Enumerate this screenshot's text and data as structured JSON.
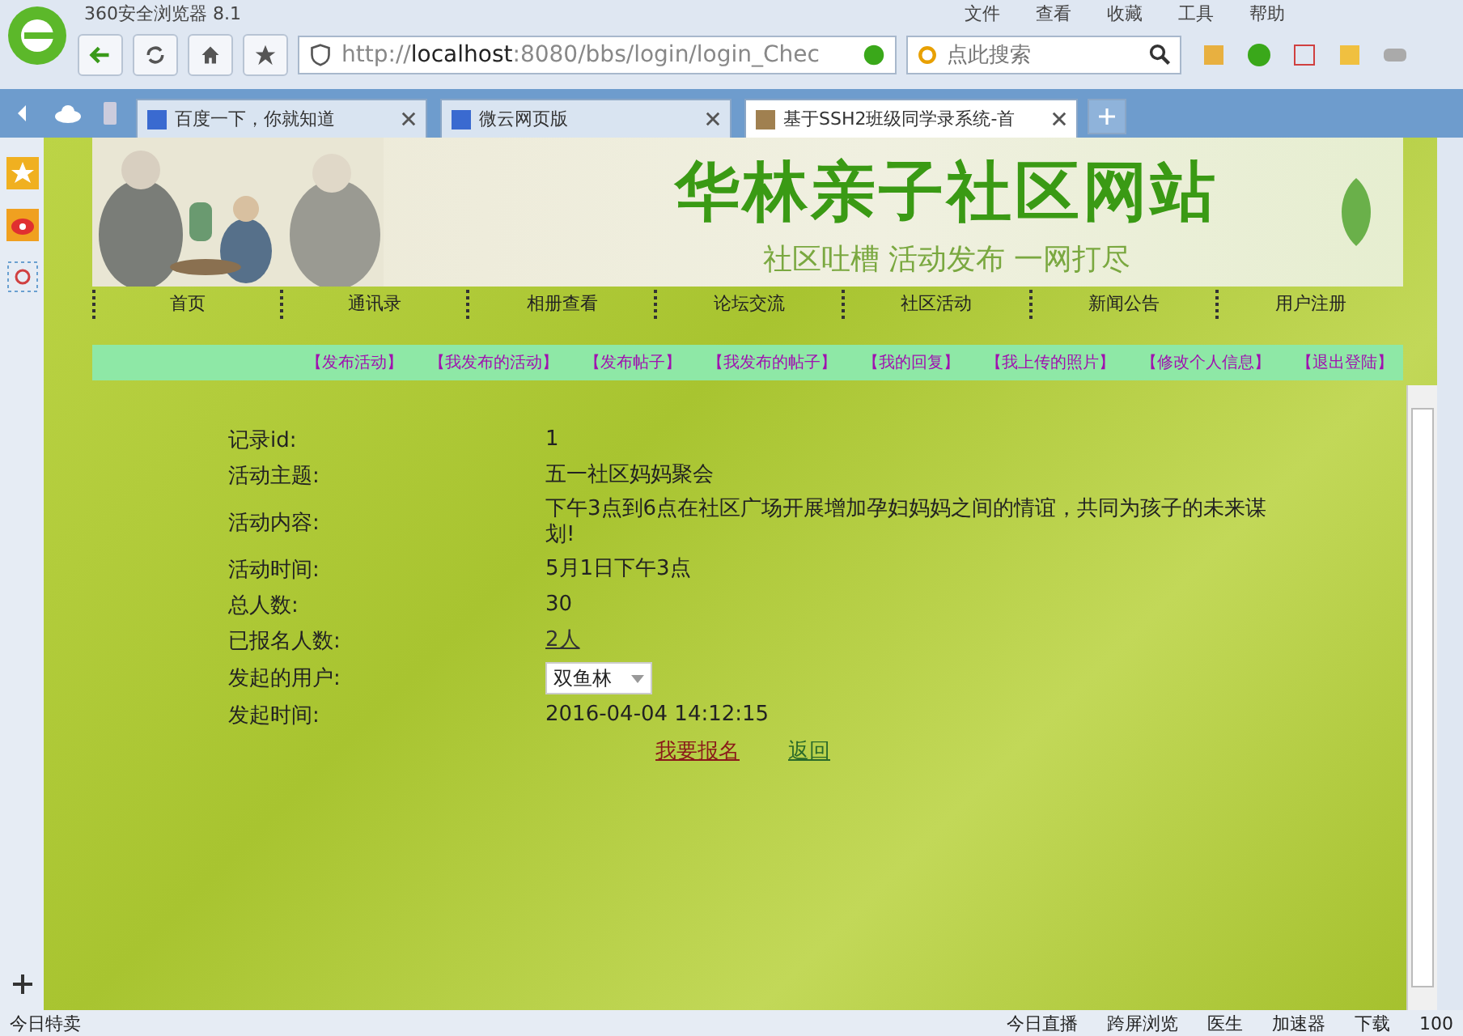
{
  "browser": {
    "title": "360安全浏览器 8.1",
    "menu": [
      "文件",
      "查看",
      "收藏",
      "工具",
      "帮助"
    ],
    "address": {
      "prefix": "http://",
      "host": "localhost",
      "rest": ":8080/bbs/login/login_Chec"
    },
    "search": {
      "placeholder": "点此搜索"
    }
  },
  "tabs": [
    {
      "label": "百度一下，你就知道",
      "selected": false
    },
    {
      "label": "微云网页版",
      "selected": false
    },
    {
      "label": "基于SSH2班级同学录系统-首",
      "selected": true
    }
  ],
  "banner": {
    "title": "华林亲子社区网站",
    "subtitle": "社区吐槽 活动发布 一网打尽"
  },
  "nav": [
    "首页",
    "通讯录",
    "相册查看",
    "论坛交流",
    "社区活动",
    "新闻公告",
    "用户注册"
  ],
  "sublinks": [
    "【发布活动】",
    "【我发布的活动】",
    "【发布帖子】",
    "【我发布的帖子】",
    "【我的回复】",
    "【我上传的照片】",
    "【修改个人信息】",
    "【退出登陆】"
  ],
  "details": [
    {
      "label": "记录id:",
      "value": "1",
      "kind": "text"
    },
    {
      "label": "活动主题:",
      "value": "五一社区妈妈聚会",
      "kind": "text"
    },
    {
      "label": "活动内容:",
      "value": "下午3点到6点在社区广场开展增加孕妇妈妈之间的情谊，共同为孩子的未来谋划!",
      "kind": "text"
    },
    {
      "label": "活动时间:",
      "value": "5月1日下午3点",
      "kind": "text"
    },
    {
      "label": "总人数:",
      "value": "30",
      "kind": "text"
    },
    {
      "label": "已报名人数:",
      "value": "2人",
      "kind": "link"
    },
    {
      "label": "发起的用户:",
      "value": "双鱼林",
      "kind": "select"
    },
    {
      "label": "发起时间:",
      "value": "2016-04-04 14:12:15",
      "kind": "text"
    }
  ],
  "actions": [
    "我要报名",
    "返回"
  ],
  "status_bar": {
    "left": "今日特卖",
    "items": [
      "今日直播",
      "跨屏浏览",
      "医生",
      "加速器",
      "下载"
    ],
    "zoom": "100"
  }
}
